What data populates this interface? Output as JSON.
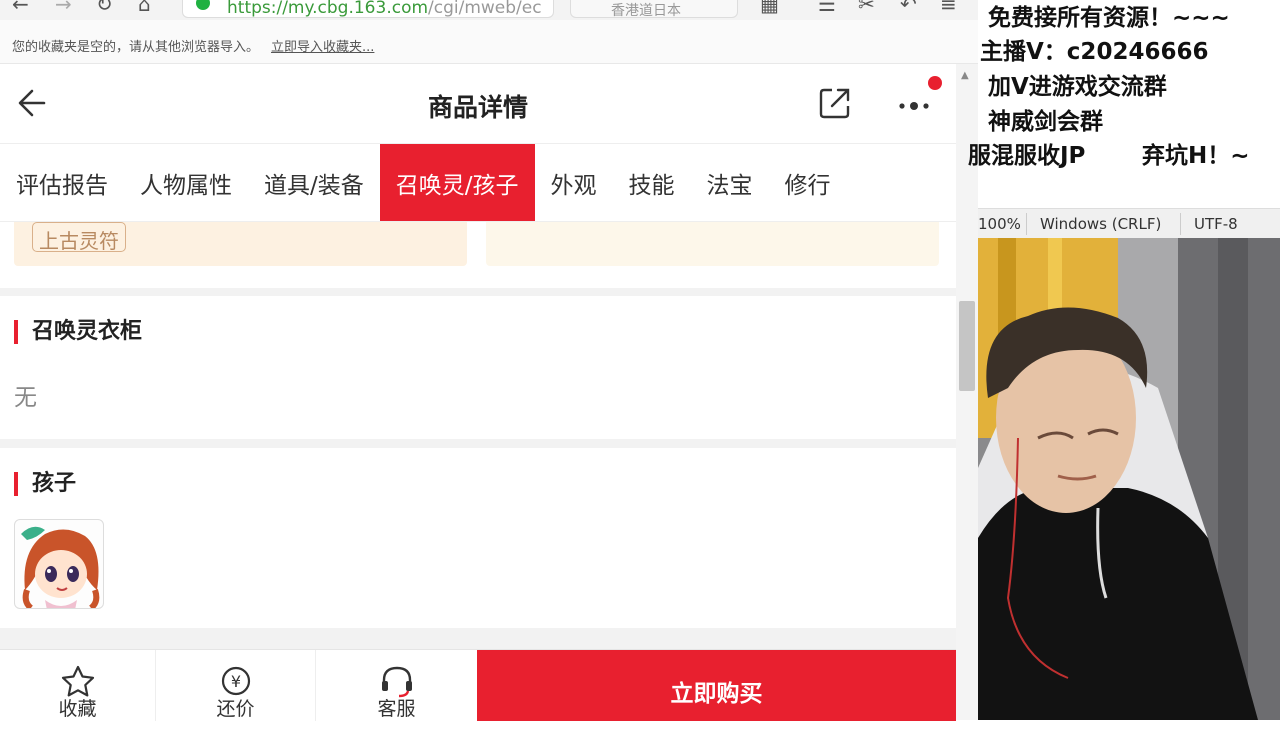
{
  "browser": {
    "url_host": "https://my.cbg.163.com",
    "url_path": "/cgi/mweb/ec",
    "search_placeholder": "香港道日本",
    "bookmarks_notice": "您的收藏夹是空的，请从其他浏览器导入。",
    "bookmarks_import_link": "立即导入收藏夹..."
  },
  "header": {
    "title": "商品详情"
  },
  "tabs": [
    {
      "label": "评估报告",
      "active": false
    },
    {
      "label": "人物属性",
      "active": false
    },
    {
      "label": "道具/装备",
      "active": false
    },
    {
      "label": "召唤灵/孩子",
      "active": true
    },
    {
      "label": "外观",
      "active": false
    },
    {
      "label": "技能",
      "active": false
    },
    {
      "label": "法宝",
      "active": false
    },
    {
      "label": "修行",
      "active": false
    }
  ],
  "content": {
    "tag_label": "上古灵符",
    "wardrobe_title": "召唤灵衣柜",
    "wardrobe_empty": "无",
    "kids_title": "孩子"
  },
  "bottom_bar": {
    "favorite_label": "收藏",
    "bargain_label": "还价",
    "service_label": "客服",
    "buy_label": "立即购买"
  },
  "overlay": {
    "line1": "免费接所有资源！~~~",
    "line2": "主播V：c20246666",
    "line3": "加V进游戏交流群",
    "line4": "神威剑会群",
    "line5": "服混服收JP",
    "line6": "弃坑H！~"
  },
  "statusbar": {
    "zoom": "100%",
    "line_endings": "Windows (CRLF)",
    "encoding": "UTF-8"
  },
  "colors": {
    "accent": "#e8202f",
    "tag_bg": "#fdf1e1"
  }
}
